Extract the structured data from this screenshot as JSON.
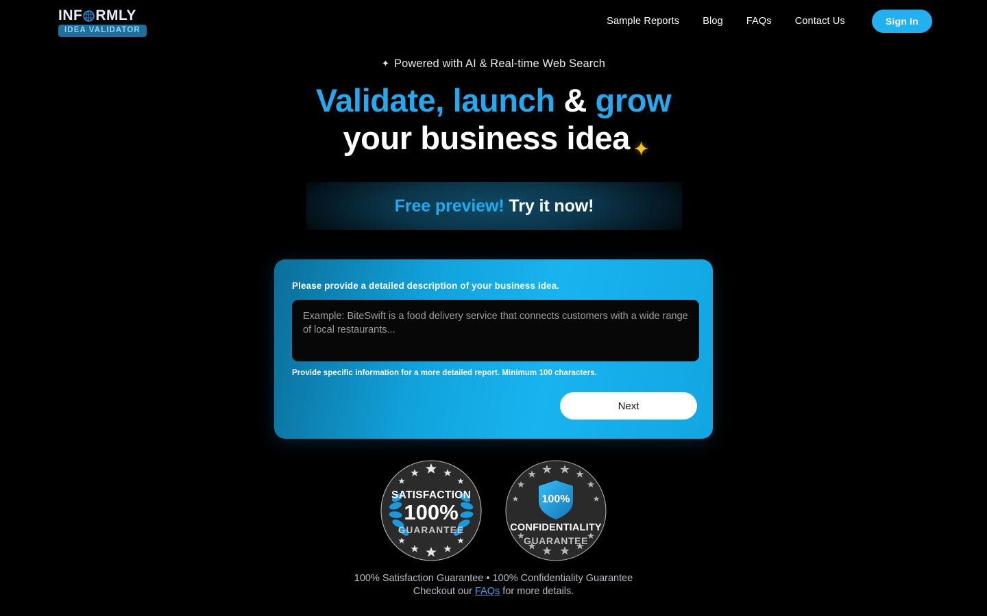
{
  "brand": {
    "name_part1": "INF",
    "name_part2": "RMLY",
    "globe_icon": "globe-icon",
    "tagline_badge": "IDEA VALIDATOR"
  },
  "nav": {
    "items": [
      {
        "label": "Sample Reports",
        "name": "nav-sample-reports"
      },
      {
        "label": "Blog",
        "name": "nav-blog"
      },
      {
        "label": "FAQs",
        "name": "nav-faqs"
      },
      {
        "label": "Contact Us",
        "name": "nav-contact-us"
      }
    ],
    "signin_label": "Sign In"
  },
  "hero": {
    "eyebrow_icon": "sparkle-icon",
    "eyebrow": "Powered with AI & Real-time Web Search",
    "headline_line1_a": "Validate, launch",
    "headline_line1_amp": " & ",
    "headline_line1_b": "grow",
    "headline_line2": "your business idea",
    "headline_sparkle": "sparkle-gold-icon"
  },
  "preview_banner": {
    "highlight": "Free preview!",
    "rest": " Try it now!"
  },
  "form": {
    "label": "Please provide a detailed description of your business idea.",
    "textarea_value": "",
    "textarea_placeholder": "Example: BiteSwift is a food delivery service that connects customers with a wide range of local restaurants...",
    "hint": "Provide specific information for a more detailed report. Minimum 100 characters.",
    "next_label": "Next"
  },
  "seals": [
    {
      "name": "satisfaction-guarantee-seal",
      "line1": "SATISFACTION",
      "line2": "100%",
      "line3": "GUARANTEE"
    },
    {
      "name": "confidentiality-guarantee-seal",
      "shield_text": "100%",
      "line1": "CONFIDENTIALITY",
      "line2": "GUARANTEE"
    }
  ],
  "footer": {
    "line1": "100% Satisfaction Guarantee • 100% Confidentiality Guarantee",
    "line2_before": "Checkout our ",
    "link": "FAQs",
    "line2_after": " for more details."
  },
  "colors": {
    "background": "#000000",
    "accent_blue": "#22a9ee",
    "signin_blue": "#22b0f0",
    "badge_blue": "#1d6f9e",
    "card_gradient_start": "#0b6e99",
    "card_gradient_end": "#12a6e2",
    "sparkle_gold": "#f5c518",
    "link_blue": "#4aa3e8"
  }
}
